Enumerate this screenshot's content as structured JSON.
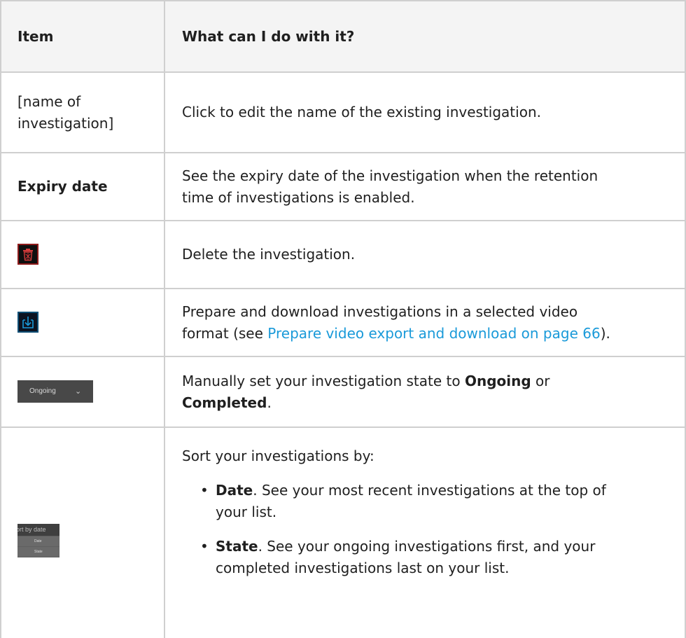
{
  "table": {
    "headers": {
      "item": "Item",
      "action": "What can I do with it?"
    },
    "rows": {
      "name": {
        "item_line1": "[name of",
        "item_line2": "investigation]",
        "text": "Click to edit the name of the existing investigation."
      },
      "expiry": {
        "item": "Expiry date",
        "text_line1": "See the expiry date of the investigation when the retention",
        "text_line2": "time of investigations is enabled."
      },
      "delete": {
        "icon": "trash-icon",
        "icon_color": "#c0392b",
        "text": "Delete the investigation."
      },
      "download": {
        "icon": "download-icon",
        "icon_color": "#1a9ad9",
        "text_line1": "Prepare and download investigations in a selected video",
        "text_line2_pre": "format (see ",
        "link": "Prepare video export and download on page 66",
        "text_line2_post": ")."
      },
      "state": {
        "dropdown_value": "Ongoing",
        "dropdown_icon": "chevron-down-icon",
        "text_pre": "Manually set your investigation state to ",
        "ongoing": "Ongoing",
        "text_mid": " or",
        "completed": "Completed",
        "text_post": "."
      },
      "sort": {
        "dropdown_label": "Sort by date",
        "option_1": "Date",
        "option_2": "State",
        "intro": "Sort your investigations by:",
        "bullet_1_term": "Date",
        "bullet_1_line1": ". See your most recent investigations at the top of",
        "bullet_1_line2": "your list.",
        "bullet_2_term": "State",
        "bullet_2_line1": ". See your ongoing investigations first, and your",
        "bullet_2_line2": "completed investigations last on your list."
      }
    }
  },
  "colors": {
    "header_background": "#f4f4f4",
    "border": "#cfcfcf",
    "link": "#1a9ad9"
  }
}
